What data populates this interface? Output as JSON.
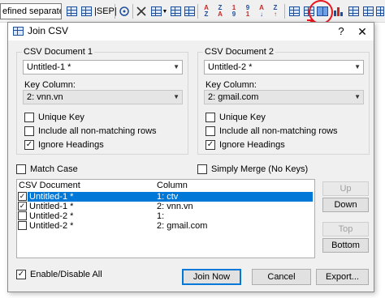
{
  "toolbar": {
    "combo_value": "efined separated",
    "sep_label": "|SEP|",
    "highlight_color": "#e8161f"
  },
  "dialog": {
    "title": "Join CSV",
    "help": "?",
    "close": "✕",
    "doc1": {
      "group_title": "CSV Document 1",
      "document": "Untitled-1 *",
      "key_column_label": "Key Column:",
      "key_column": "2: vnn.vn",
      "unique_key": {
        "label": "Unique Key",
        "checked": false
      },
      "include_non_matching": {
        "label": "Include all non-matching rows",
        "checked": false
      },
      "ignore_headings": {
        "label": "Ignore Headings",
        "checked": true
      }
    },
    "doc2": {
      "group_title": "CSV Document 2",
      "document": "Untitled-2 *",
      "key_column_label": "Key Column:",
      "key_column": "2: gmail.com",
      "unique_key": {
        "label": "Unique Key",
        "checked": false
      },
      "include_non_matching": {
        "label": "Include all non-matching rows",
        "checked": false
      },
      "ignore_headings": {
        "label": "Ignore Headings",
        "checked": true
      }
    },
    "match_case": {
      "label": "Match Case",
      "checked": false
    },
    "simply_merge": {
      "label": "Simply Merge (No Keys)",
      "checked": false
    },
    "list": {
      "headers": [
        "CSV Document",
        "Column"
      ],
      "rows": [
        {
          "doc": "Untitled-1 *",
          "column": "1: ctv",
          "checked": true,
          "selected": true
        },
        {
          "doc": "Untitled-1 *",
          "column": "2: vnn.vn",
          "checked": true,
          "selected": false
        },
        {
          "doc": "Untitled-2 *",
          "column": "1:",
          "checked": false,
          "selected": false
        },
        {
          "doc": "Untitled-2 *",
          "column": "2: gmail.com",
          "checked": false,
          "selected": false
        }
      ]
    },
    "buttons": {
      "up": "Up",
      "down": "Down",
      "top": "Top",
      "bottom": "Bottom",
      "join_now": "Join Now",
      "cancel": "Cancel",
      "export": "Export..."
    },
    "enable_disable_all": {
      "label": "Enable/Disable All",
      "checked": true
    }
  }
}
